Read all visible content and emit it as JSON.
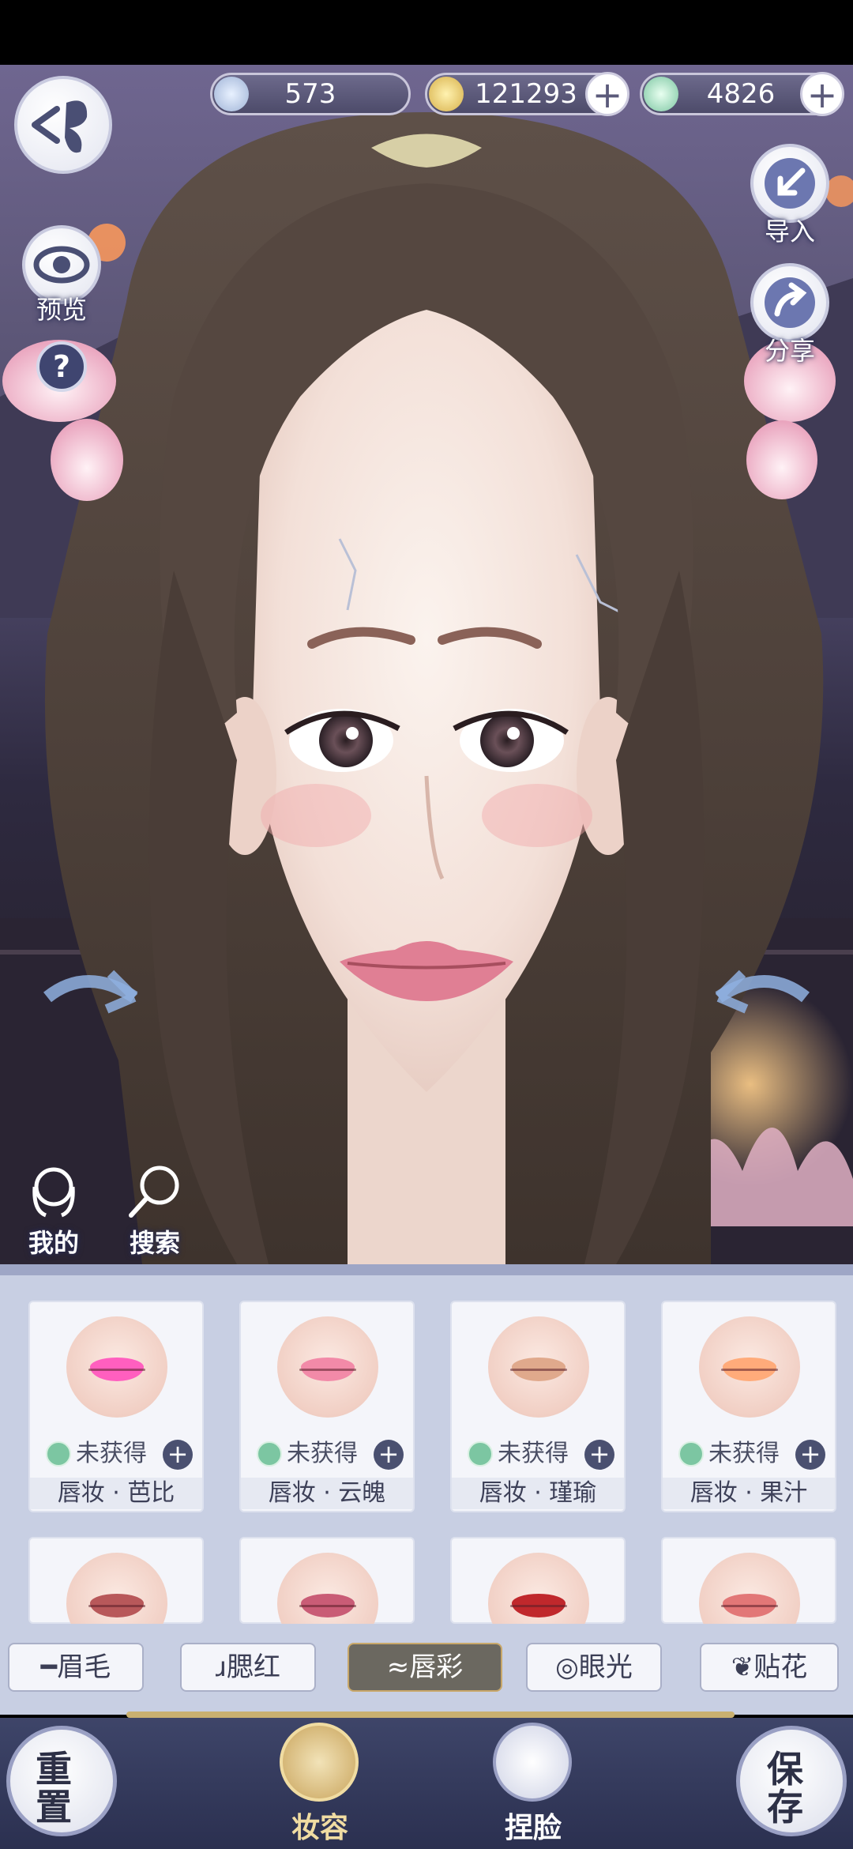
{
  "currency": [
    {
      "icon": "silver-feather-icon",
      "value": "573",
      "has_plus": false
    },
    {
      "icon": "gold-coin-icon",
      "value": "121293",
      "has_plus": true
    },
    {
      "icon": "jade-token-icon",
      "value": "4826",
      "has_plus": true
    }
  ],
  "left_buttons": {
    "preview": "预览",
    "help": "?"
  },
  "right_buttons": {
    "import": "导入",
    "share": "分享"
  },
  "quick": {
    "mine": "我的",
    "search": "搜索"
  },
  "items": [
    {
      "status": "未获得",
      "name": "唇妆 · 芭比",
      "lip_color": "#ff5fbf"
    },
    {
      "status": "未获得",
      "name": "唇妆 · 云魄",
      "lip_color": "#f28aa8"
    },
    {
      "status": "未获得",
      "name": "唇妆 · 瑾瑜",
      "lip_color": "#e0a98c"
    },
    {
      "status": "未获得",
      "name": "唇妆 · 果汁",
      "lip_color": "#ffab7a"
    },
    {
      "lip_color": "#b8585a"
    },
    {
      "lip_color": "#c95c76"
    },
    {
      "lip_color": "#c0282c"
    },
    {
      "lip_color": "#e27777"
    }
  ],
  "tabs": [
    {
      "label": "眉毛",
      "active": false
    },
    {
      "label": "腮红",
      "active": false
    },
    {
      "label": "唇彩",
      "active": true
    },
    {
      "label": "眼光",
      "active": false
    },
    {
      "label": "贴花",
      "active": false
    }
  ],
  "nav": {
    "reset": "重置",
    "makeup": "妆容",
    "face": "捏脸",
    "save": "保存"
  }
}
